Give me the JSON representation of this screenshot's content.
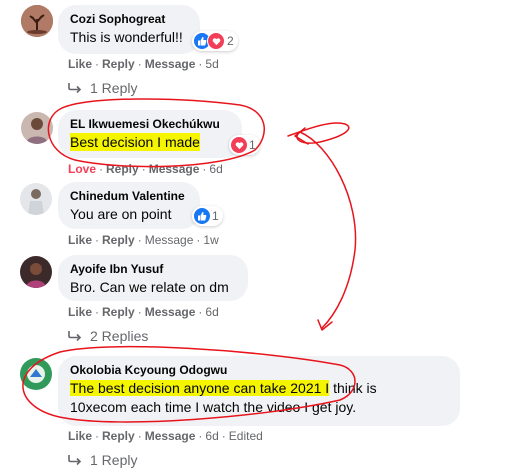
{
  "comments": [
    {
      "author": "Cozi Sophogreat",
      "text": "This is wonderful!!",
      "reaction_count": "2",
      "actions": {
        "like": "Like",
        "reply": "Reply",
        "message": "Message",
        "age": "5d"
      },
      "replies_label": "1 Reply"
    },
    {
      "author": "EL Ikwuemesi Okechúkwu",
      "text": "Best decision I made",
      "reaction_count": "1",
      "actions": {
        "like": "Love",
        "reply": "Reply",
        "message": "Message",
        "age": "6d"
      }
    },
    {
      "author": "Chinedum Valentine",
      "text": "You are on point",
      "reaction_count": "1",
      "actions": {
        "like": "Like",
        "reply": "Reply",
        "message": "Message",
        "age": "1w"
      }
    },
    {
      "author": "Ayoife Ibn Yusuf",
      "text": "Bro. Can we relate on dm",
      "actions": {
        "like": "Like",
        "reply": "Reply",
        "message": "Message",
        "age": "6d"
      },
      "replies_label": "2 Replies"
    },
    {
      "author": "Okolobia Kcyoung Odogwu",
      "text_highlight": "The best decision anyone can take 2021 I",
      "text_rest_1": " think is",
      "text_line2": "10xecom each time I watch the video I get joy.",
      "actions": {
        "like": "Like",
        "reply": "Reply",
        "message": "Message",
        "age": "6d",
        "edited": "Edited"
      },
      "replies_label": "1 Reply"
    }
  ],
  "colors": {
    "like_blue": "#385898",
    "love_red": "#f33e58",
    "highlight": "#f5f500",
    "annotation_red": "#e8141c",
    "bubble": "#f0f2f5"
  },
  "separator": "·"
}
